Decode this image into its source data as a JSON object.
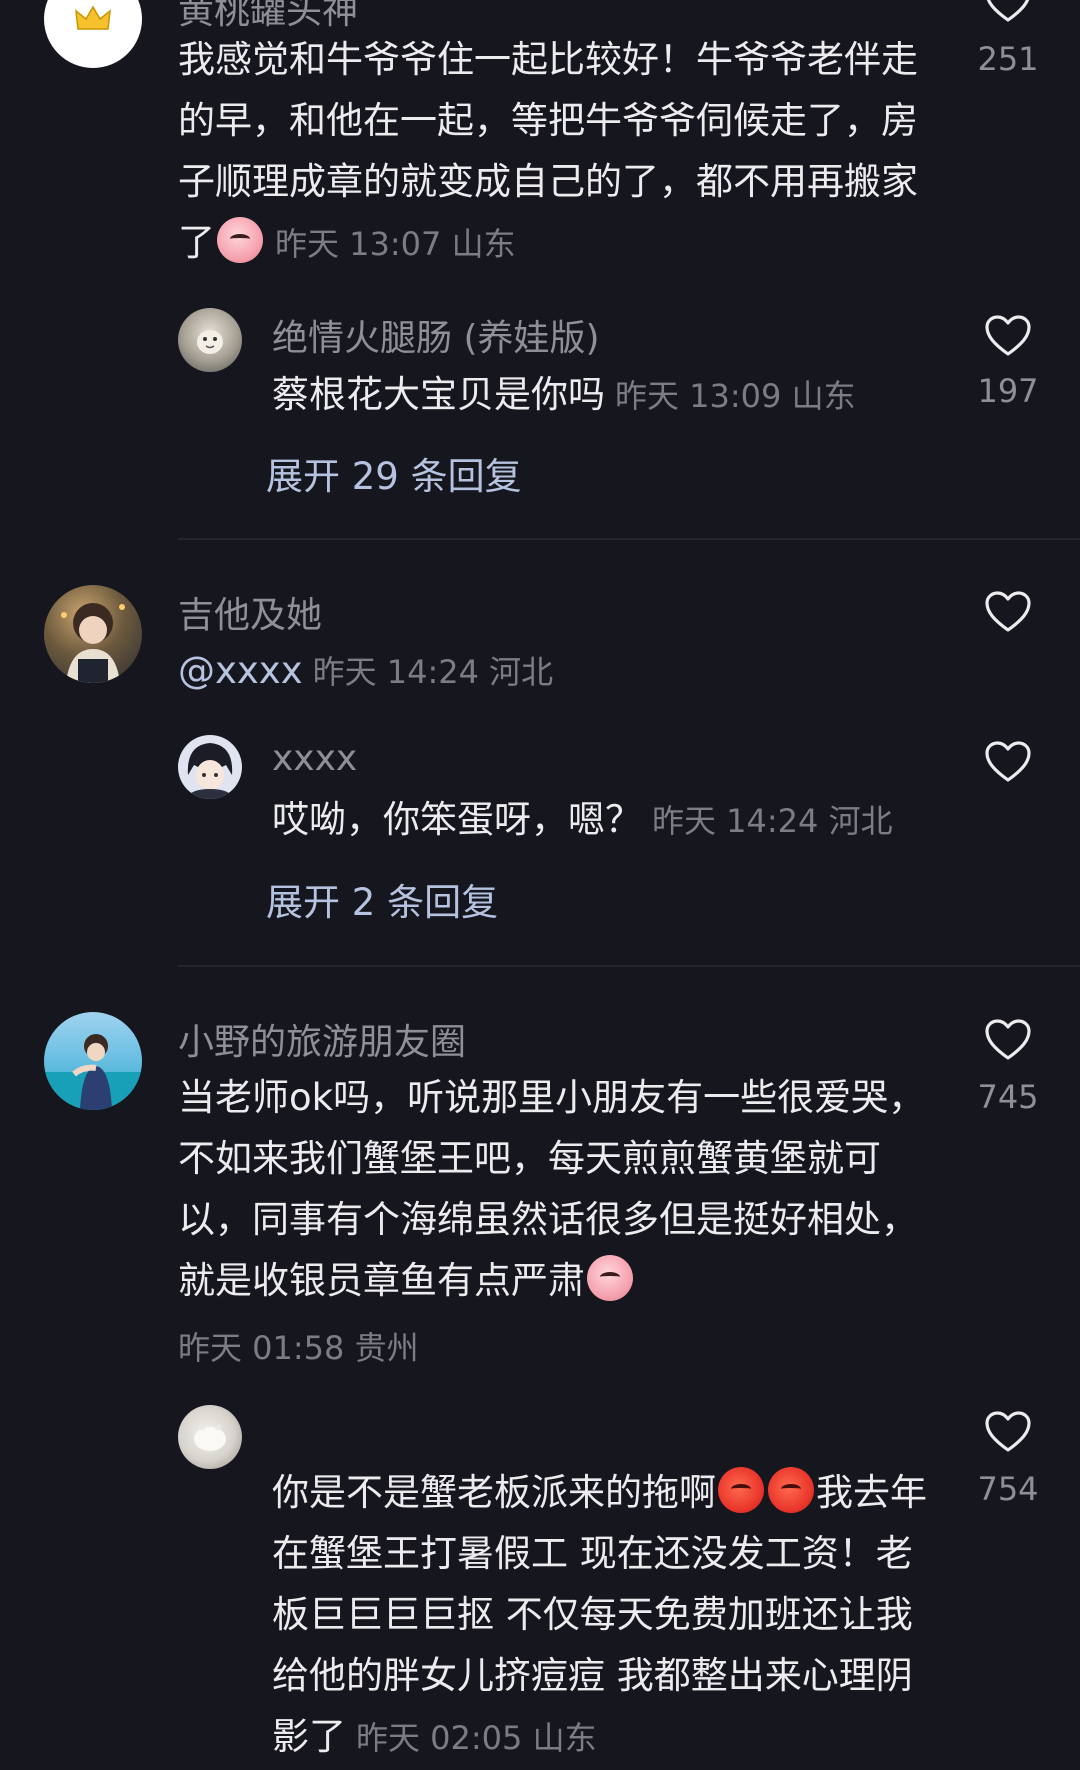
{
  "colors": {
    "background": "#16161e",
    "text": "#ececee",
    "muted": "#8f8f96",
    "link": "#b6c3e0"
  },
  "comments": [
    {
      "user": "黄桃罐头神",
      "avatar_icon": "crown-icon",
      "text": "我感觉和牛爷爷住一起比较好！牛爷爷老伴走的早，和他在一起，等把牛爷爷伺候走了，房子顺理成章的就变成自己的了，都不用再搬家了",
      "emoji": "angry-face-emoji",
      "time": "昨天 13:07 山东",
      "likes": "251",
      "reply": {
        "user": "绝情火腿肠 (养娃版)",
        "avatar_icon": "white-tiger-avatar",
        "text": "蔡根花大宝贝是你吗",
        "time": "昨天 13:09 山东",
        "likes": "197"
      },
      "expand": "展开 29 条回复"
    },
    {
      "user": "吉他及她",
      "avatar_icon": "girl-photo-avatar",
      "text": "@xxxx",
      "time": "昨天 14:24 河北",
      "likes": "",
      "reply": {
        "user": "xxxx",
        "avatar_icon": "anime-boy-avatar",
        "text": "哎呦，你笨蛋呀，嗯？",
        "time": "昨天 14:24 河北",
        "likes": ""
      },
      "expand": "展开 2 条回复"
    },
    {
      "user": "小野的旅游朋友圈",
      "avatar_icon": "beach-photo-avatar",
      "text": "当老师ok吗，听说那里小朋友有一些很爱哭，不如来我们蟹堡王吧，每天煎煎蟹黄堡就可以，同事有个海绵虽然话很多但是挺好相处，就是收银员章鱼有点严肃",
      "emoji": "smirk-face-emoji",
      "time": "昨天 01:58 贵州",
      "likes": "745",
      "reply": {
        "user": "",
        "avatar_icon": "white-cat-avatar",
        "text_a": "你是不是蟹老板派来的拖啊",
        "emoji": "angry-red-face-emoji",
        "text_b": "我去年在蟹堡王打暑假工 现在还没发工资！老板巨巨巨巨抠 不仅每天免费加班还让我给他的胖女儿挤痘痘 我都整出来心理阴影了",
        "time": "昨天 02:05 山东",
        "likes": "754"
      }
    }
  ]
}
